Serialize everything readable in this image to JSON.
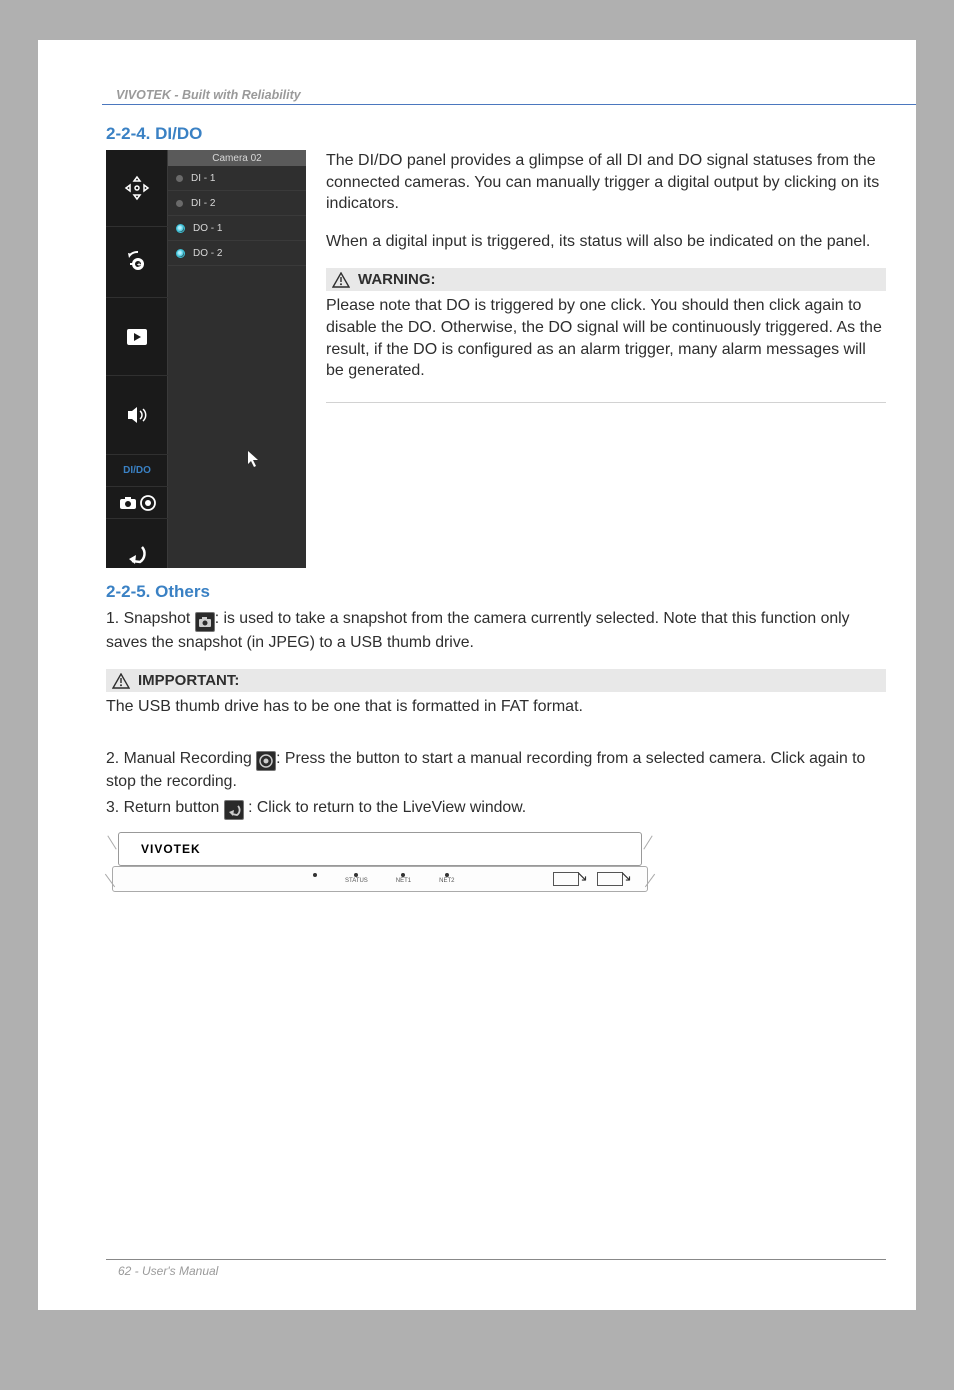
{
  "header": "VIVOTEK - Built with Reliability",
  "section_2_2_4": {
    "title": "2-2-4. DI/DO",
    "para1": "The DI/DO panel provides a glimpse of all DI and DO signal statuses from the connected cameras. You can manually trigger a digital output by clicking on its indicators.",
    "para2": "When a digital input is triggered, its status will also be indicated on the panel.",
    "warning_label": "WARNING:",
    "warning_text": "Please note that DO is triggered by one click. You should then click again to disable the DO. Otherwise, the DO signal will be continuously triggered. As the result, if the DO is configured as an alarm trigger, many alarm messages will be generated."
  },
  "dido_panel": {
    "camera": "Camera 02",
    "di1": "DI - 1",
    "di2": "DI - 2",
    "do1": "DO - 1",
    "do2": "DO - 2",
    "dido_label": "DI/DO"
  },
  "section_2_2_5": {
    "title": "2-2-5. Others",
    "item1_prefix": "1. Snapshot ",
    "item1_suffix": ": is used to take a snapshot from the camera currently selected. Note that this function only saves the snapshot (in JPEG) to a USB thumb drive.",
    "important_label": "IMPPORTANT:",
    "important_text": "The USB thumb drive has to be one that is formatted in FAT format.",
    "item2_prefix": "2. Manual Recording ",
    "item2_suffix": ": Press the button to start a manual recording from a selected camera. Click again to stop the recording.",
    "item3_prefix": "3. Return button ",
    "item3_suffix": " : Click to return to the LiveView window."
  },
  "device": {
    "logo": "VIVOTEK",
    "status": "STATUS",
    "net1": "NET1",
    "net2": "NET2"
  },
  "footer": "62 - User's Manual"
}
